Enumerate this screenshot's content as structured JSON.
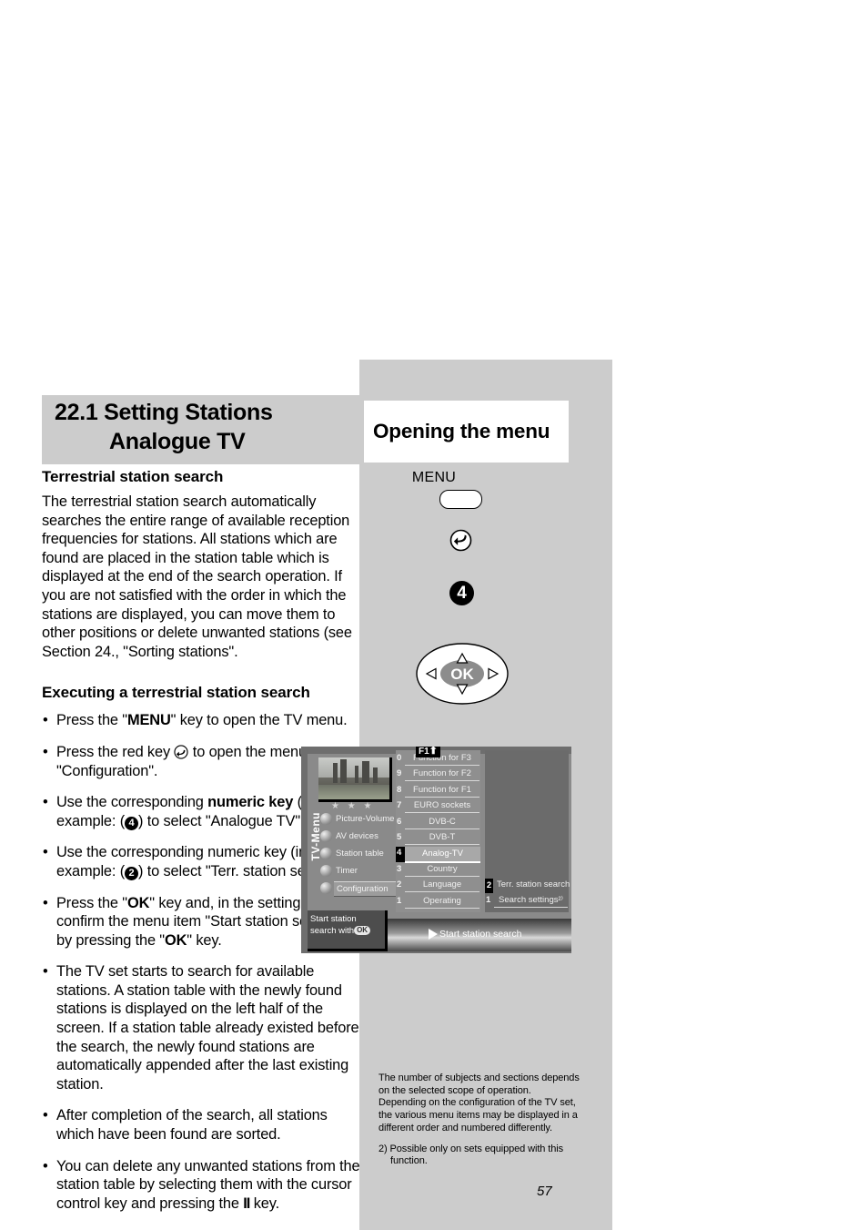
{
  "section": {
    "number_title_line1": "22.1 Setting Stations",
    "number_title_line2": "Analogue TV",
    "sub_head_1": "Terrestrial station search",
    "intro": "The terrestrial station search automatically searches the entire range of available reception frequencies for stations. All stations which are found are placed in the station table which is displayed at the end of the search operation. If you are not satisfied with the order in which the stations are displayed, you can move them to other positions or delete unwanted stations (see Section 24., \"Sorting stations\".",
    "sub_head_2": "Executing a terrestrial station search",
    "bullets": [
      {
        "parts": [
          {
            "t": "Press the \"",
            "style": "normal"
          },
          {
            "t": "MENU",
            "style": "bold"
          },
          {
            "t": "\" key to open the TV menu.",
            "style": "normal"
          }
        ]
      },
      {
        "parts": [
          {
            "t": "Press the red key ",
            "style": "normal"
          },
          {
            "t": "",
            "style": "redkey"
          },
          {
            "t": " to open the menu \"Configuration\".",
            "style": "normal"
          }
        ]
      },
      {
        "parts": [
          {
            "t": "Use the corresponding ",
            "style": "normal"
          },
          {
            "t": "numeric key",
            "style": "bold"
          },
          {
            "t": " (in the example: (",
            "style": "normal"
          },
          {
            "t": "4",
            "style": "circle"
          },
          {
            "t": ") to select \"Analogue TV\".",
            "style": "normal"
          }
        ]
      },
      {
        "parts": [
          {
            "t": "Use the corresponding numeric key (in the example: (",
            "style": "normal"
          },
          {
            "t": "2",
            "style": "circle"
          },
          {
            "t": ") to select \"Terr. station search\".",
            "style": "normal"
          }
        ]
      },
      {
        "parts": [
          {
            "t": "Press the \"",
            "style": "normal"
          },
          {
            "t": "OK",
            "style": "bold"
          },
          {
            "t": "\" key and, in the setting window, confirm the menu item \"Start station search\" by pressing the \"",
            "style": "normal"
          },
          {
            "t": "OK",
            "style": "bold"
          },
          {
            "t": "\" key.",
            "style": "normal"
          }
        ]
      },
      {
        "parts": [
          {
            "t": "The TV set starts to search for available stations. A station table with the newly found stations is displayed on the left half of the screen. If a station table already existed before the search, the newly found stations are automatically appended after the last existing station.",
            "style": "normal"
          }
        ]
      },
      {
        "parts": [
          {
            "t": "After completion of the search, all stations which have been found are sorted.",
            "style": "normal"
          }
        ]
      },
      {
        "parts": [
          {
            "t": "You can delete any unwanted stations from the station table by selecting them with the cursor control key and pressing the ",
            "style": "normal"
          },
          {
            "t": "II",
            "style": "pause"
          },
          {
            "t": " key.",
            "style": "normal"
          }
        ]
      }
    ]
  },
  "right": {
    "chapter_heading": "Opening the menu",
    "menu_key_label": "MENU",
    "back_key_icon": "return-arrow-icon",
    "digit_key_label": "4",
    "navpad_ok_label": "OK",
    "navpad_icons": [
      "arrow-up-icon",
      "arrow-left-icon",
      "arrow-right-icon",
      "arrow-down-icon"
    ],
    "footnote_main": "The number of subjects and sections depends on the selected scope of operation. Depending on the configuration of the TV set, the various menu items may be displayed in a different order and numbered differently.",
    "footnote_2": "2) Possible only on sets equipped with this function."
  },
  "tv_screen": {
    "f1_badge": "F1",
    "rail_title": "TV-Menu",
    "stars": "★ ★ ★",
    "rail_items": [
      {
        "label": "Picture-Volume",
        "selected": false
      },
      {
        "label": "AV devices",
        "selected": false
      },
      {
        "label": "Station table",
        "selected": false
      },
      {
        "label": "Timer",
        "selected": false
      },
      {
        "label": "Configuration",
        "selected": true
      }
    ],
    "mid_column": [
      {
        "num": "0",
        "label": "Function for F3",
        "state": "normal"
      },
      {
        "num": "9",
        "label": "Function for F2",
        "state": "normal"
      },
      {
        "num": "8",
        "label": "Function for F1",
        "state": "normal"
      },
      {
        "num": "7",
        "label": "EURO sockets",
        "state": "normal"
      },
      {
        "num": "6",
        "label": "DVB-C",
        "state": "normal"
      },
      {
        "num": "5",
        "label": "DVB-T",
        "state": "normal"
      },
      {
        "num": "4",
        "label": "Analog-TV",
        "state": "highlighted"
      },
      {
        "num": "3",
        "label": "Country",
        "state": "normal"
      },
      {
        "num": "2",
        "label": "Language",
        "state": "normal"
      },
      {
        "num": "1",
        "label": "Operating",
        "state": "normal"
      }
    ],
    "right_column": [
      {
        "num": "2",
        "label": "Terr. station search",
        "state": "highlighted"
      },
      {
        "num": "1",
        "label": "Search settings²⁾",
        "state": "normal"
      }
    ],
    "tooltip_line1": "Start station",
    "tooltip_line2": "search with",
    "tooltip_ok": "OK",
    "bottom_bar_label": "Start station search"
  },
  "page": {
    "number": "57"
  }
}
